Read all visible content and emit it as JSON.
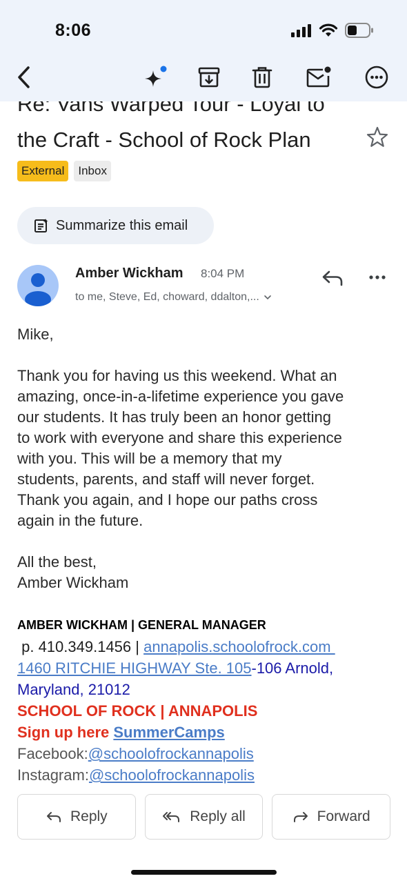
{
  "status": {
    "time": "8:06"
  },
  "email": {
    "subject_line1": "Re: Vans Warped Tour - Loyal to",
    "subject_line2": "the Craft - School of Rock Plan",
    "labels": [
      "External",
      "Inbox"
    ],
    "summarize_label": "Summarize this email",
    "sender": "Amber Wickham",
    "time": "8:04 PM",
    "recipients": "to me, Steve, Ed, choward, ddalton,...",
    "greeting": "Mike,",
    "body_lines": [
      "Thank you for having us this weekend. What an",
      "amazing, once-in-a-lifetime experience you gave",
      "our students. It has truly been an honor getting",
      "to work with everyone and share this experience",
      "with you. This will be a memory that my",
      "students, parents, and staff will never forget.",
      "Thank you again, and I hope our paths cross",
      "again in the future."
    ],
    "closing": "All the best,",
    "closing_name": "Amber Wickham"
  },
  "signature": {
    "title": "AMBER WICKHAM | GENERAL MANAGER",
    "phone_prefix": " p. 410.349.1456 | ",
    "website": "annapolis.schoolofrock.com ",
    "address_link": "1460 RITCHIE HIGHWAY Ste. 105",
    "address_rest": "-106 Arnold,",
    "address_line2": "Maryland, 21012",
    "school": "SCHOOL OF ROCK | ANNAPOLIS",
    "signup_prefix": "Sign up here ",
    "signup_link": "SummerCamps",
    "facebook_label": "Facebook:",
    "facebook_handle": "@schoolofrockannapolis",
    "instagram_label": "Instagram:",
    "instagram_handle": "@schoolofrockannapolis"
  },
  "actions": {
    "reply": "Reply",
    "reply_all": "Reply all",
    "forward": "Forward"
  },
  "colors": {
    "topbar": "#eef3fb",
    "external_chip": "#f6bc1b",
    "link": "#4a7cc7",
    "school_red": "#e0301e"
  },
  "icons": [
    "back-arrow-icon",
    "sparkle-icon",
    "archive-icon",
    "trash-icon",
    "mark-unread-icon",
    "more-icon",
    "star-icon",
    "summarize-icon",
    "reply-icon",
    "reply-all-icon",
    "forward-icon"
  ]
}
